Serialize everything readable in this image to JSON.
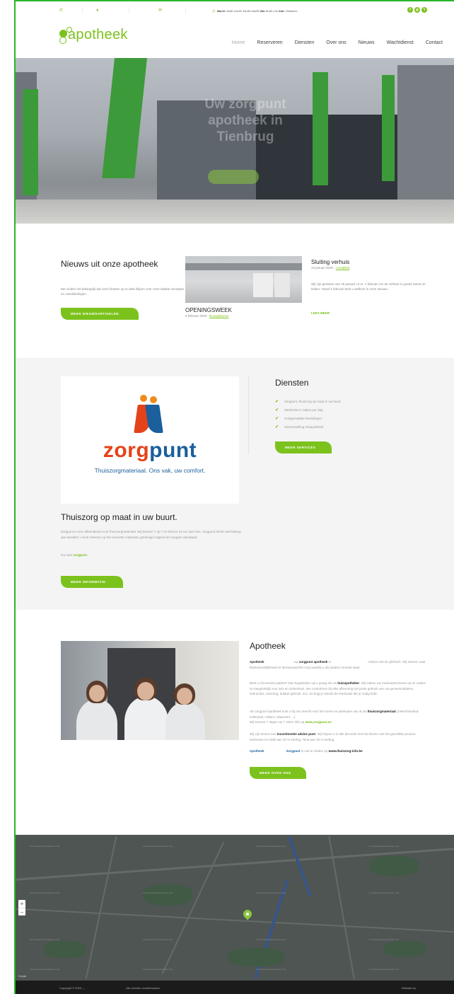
{
  "topbar": {
    "hours_label": "Ma-Vr:",
    "hours_weekdays": "8u30-12u30 13u30-18u30",
    "sat_label": "Zat:",
    "sat_hours": "8u30-12u",
    "sun_label": "Zon:",
    "sun_hours": "Gesloten -",
    "icons": [
      "phone-icon",
      "location-pin-icon",
      "mail-icon"
    ],
    "social": [
      "facebook-icon",
      "instagram-icon",
      "messenger-icon"
    ]
  },
  "header": {
    "logo_text": "apotheek",
    "nav": [
      "Home",
      "Reserveren",
      "Diensten",
      "Over ons",
      "Nieuws",
      "Wachtdienst",
      "Contact"
    ],
    "active_nav": "Home"
  },
  "hero": {
    "title": "Uw zorgpunt apotheek in Tienbrug"
  },
  "news": {
    "title": "Nieuws uit onze apotheek",
    "description": "We vinden het belangrijk dat onze klanten up to date blijven over onze laatste nieuwtjes en ontwikkelingen.",
    "button": "MEER NIEUWSARTIKELEN",
    "post1": {
      "title": "OPENINGSWEEK",
      "date": "6 februari 2020 -",
      "category": "Bouwplannen"
    },
    "post2": {
      "title": "Sluiting verhuis",
      "date": "13 januari 2020 -",
      "category": "Actualiteit",
      "text": "Wij zijn gesloten van 29 januari t.e.m. 1 februari om de verhuis in goede banen te leiden. Vanaf 2 februari bent u welkom in onze nieuwe...",
      "read_more": "LEES MEER"
    }
  },
  "services": {
    "zorgpunt_logo_word_1": "zorg",
    "zorgpunt_logo_word_2": "punt",
    "zorgpunt_tagline": "Thuiszorgmateriaal. Ons vak, uw comfort.",
    "title": "Diensten",
    "items": [
      "Zorgpunt, thuiszorg op maat in uw buurt",
      "Medicatie in zakjes per dag",
      "Huisgemaakte bereidingen",
      "Samenstelling reisapotheek"
    ],
    "button": "MEER SERVICES",
    "thuiszorg_title": "Thuiszorg op maat in uw buurt.",
    "thuiszorg_text": "Zorgpunt is een uitleendienst voor thuiszorgmateriaal. Wij leveren 7 op 7 en binnen 24 uur aan huis. Zorgpunt hecht veel belang aan kwaliteit: u kunt rekenen op het nieuwste materiaal, gereinigd volgend de hoogste standaard.",
    "link_prefix": "Ga naar",
    "link_text": "zorgpunt.",
    "info_button": "MEER INFORMATIE"
  },
  "about": {
    "title": "Apotheek",
    "p1_a": "Apotheek",
    "p1_b": ", uw",
    "p1_c": "zorgpunt apotheek",
    "p1_d": "in",
    "p1_e": ". Advies met de glimlach. Wij streven naar klantvriendelijkheid en farmaceutische zorg waarbij u als patiënt centraal staat.",
    "p2_a": "Bent u chronische patiënt? Dan begeleiden wij u graag als uw",
    "p2_b": "huisspotheker",
    "p2_c": ". Wij maken uw medicatieschema op en maken ze toegankelijk voor arts en ziekenhuis. We controleren bij elke aflevering het juiste gebruik van uw geneesmiddelen, interacties, dosering, dubbel gebruik, enz. Zo krijg je steeds de medicatie die je nodig hebt.",
    "p3_a": "Als zorgpunt apotheek kunt u bij ons terecht voor het huren en aankopen van al uw",
    "p3_b": "thuiszorgmateriaal",
    "p3_c": "(ziekenhuisbed, toiletstoel, rollator, relaxzetel, ...)",
    "p3_d": "Wij leveren 7 dagen op 7. Meer info op",
    "p3_e": "www.zorgpunt.eu",
    "p4_a": "Wij zijn tevens een",
    "p4_b": "incontinentie advies punt",
    "p4_c": ". Wij helpen u in alle discretie met het kiezen van het geschikte product. Hartmann en AMD aan 40 % korting, Tena aan 20 % korting.",
    "p5_a": "Apotheek",
    "p5_b": "Zorgpunt",
    "p5_c": "is ook te vinden op",
    "p5_d": "www.thuiszorg-info.be",
    "button": "MEER OVER ONS"
  },
  "map": {
    "zoom_in": "+",
    "zoom_out": "−",
    "label": "For development purposes only",
    "google": "Google"
  },
  "footer": {
    "copyright": "Copyright © 2020 —",
    "rights": "Alle rechten voorbehouden",
    "website_by": "Website by"
  },
  "colors": {
    "accent": "#7cc21d",
    "dark": "#1b1b1b",
    "zorg_red": "#e4431a",
    "zorg_blue": "#1b5f9c"
  }
}
